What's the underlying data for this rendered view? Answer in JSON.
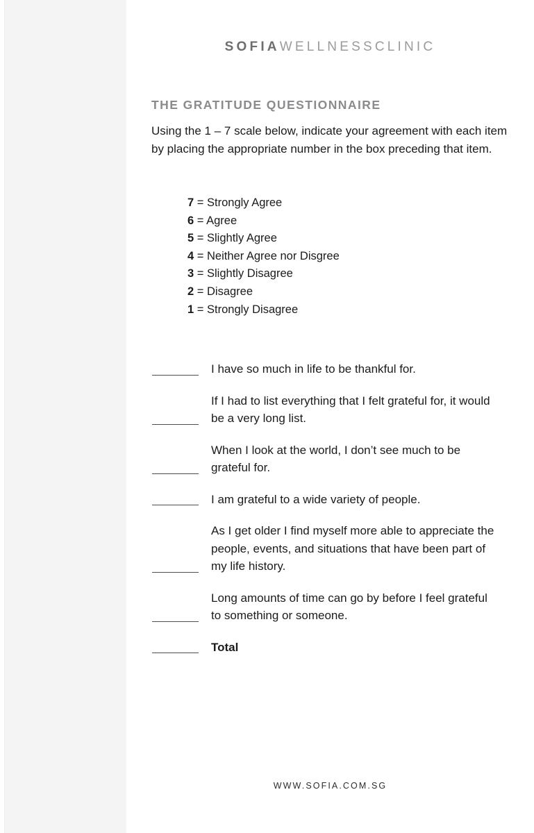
{
  "brand": {
    "strong": "SOFIA",
    "light": "WELLNESSCLINIC"
  },
  "document": {
    "title": "THE GRATITUDE QUESTIONNAIRE",
    "intro": "Using the 1 – 7 scale below, indicate your agreement with each item by placing the appropriate number in the box preceding that item."
  },
  "scale": [
    {
      "number": "7",
      "label": "= Strongly Agree"
    },
    {
      "number": "6",
      "label": "= Agree"
    },
    {
      "number": "5",
      "label": "= Slightly Agree"
    },
    {
      "number": "4",
      "label": "= Neither Agree nor Disgree"
    },
    {
      "number": "3",
      "label": "= Slightly Disagree"
    },
    {
      "number": "2",
      "label": "= Disagree"
    },
    {
      "number": "1",
      "label": "= Strongly Disagree"
    }
  ],
  "items": [
    {
      "text": "I have so much in life to be thankful for.",
      "value": ""
    },
    {
      "text": "If I had to list everything that I felt grateful for, it would be a very long list.",
      "value": ""
    },
    {
      "text": "When I look at the world, I don’t see much to be grateful for.",
      "value": ""
    },
    {
      "text": "I am grateful to a wide variety of people.",
      "value": ""
    },
    {
      "text": "As I get older I find myself more able to appreciate the people, events, and situations that have been part of my life history.",
      "value": ""
    },
    {
      "text": "Long amounts of time can go by before I feel grateful to something or someone.",
      "value": ""
    },
    {
      "text": "Total",
      "value": ""
    }
  ],
  "footer": {
    "url": "WWW.SOFIA.COM.SG"
  },
  "colors": {
    "sidebar": "#f4f4f4",
    "brand_strong": "#6e6e70",
    "brand_light": "#9b9b9d",
    "title": "#8b8b8d",
    "body": "#1b1b1b",
    "rule": "#4c4c4c"
  }
}
